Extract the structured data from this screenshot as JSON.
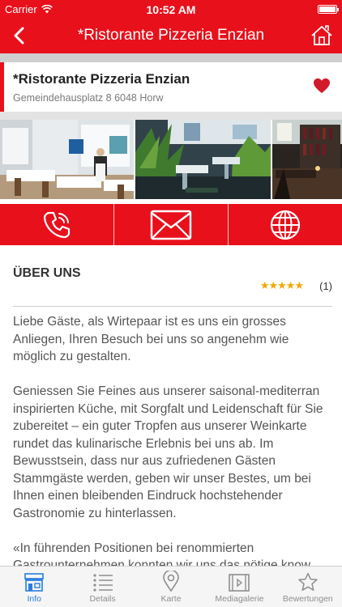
{
  "status_bar": {
    "carrier": "Carrier",
    "time": "10:52 AM"
  },
  "nav": {
    "title": "*Ristorante Pizzeria Enzian",
    "back_icon": "chevron-left-icon",
    "home_icon": "home-icon"
  },
  "restaurant": {
    "name": "*Ristorante Pizzeria Enzian",
    "address": "Gemeindehausplatz 8 6048 Horw",
    "favorite_icon": "heart-icon"
  },
  "actions": [
    {
      "name": "phone",
      "icon": "phone-icon"
    },
    {
      "name": "email",
      "icon": "envelope-icon"
    },
    {
      "name": "website",
      "icon": "globe-icon"
    }
  ],
  "about": {
    "title": "ÜBER UNS",
    "stars": "★★★★★",
    "rating": 5,
    "rating_count": "(1)",
    "paragraphs": [
      "Liebe Gäste, als Wirtepaar ist es uns ein grosses Anliegen, Ihren Besuch bei uns so angenehm wie möglich zu gestalten.",
      "Geniessen Sie Feines aus unserer saisonal-mediterran inspirierten Küche, mit Sorgfalt und Leidenschaft für Sie zubereitet – ein guter Tropfen aus unserer Weinkarte rundet das kulinarische Erlebnis bei uns ab. Im Bewusstsein, dass nur aus zufriedenen Gästen Stammgäste werden, geben wir unser Bestes, um bei Ihnen einen bleibenden Eindruck hochstehender Gastronomie zu hinterlassen.",
      "«In führenden Positionen bei renommierten Gastrounternehmen konnten wir uns das nötige know"
    ]
  },
  "tabs": [
    {
      "label": "Info",
      "icon": "store-icon",
      "active": true
    },
    {
      "label": "Details",
      "icon": "list-icon",
      "active": false
    },
    {
      "label": "Karte",
      "icon": "map-pin-icon",
      "active": false
    },
    {
      "label": "Mediagalerie",
      "icon": "film-icon",
      "active": false
    },
    {
      "label": "Bewertungen",
      "icon": "star-icon",
      "active": false
    }
  ],
  "colors": {
    "brand_red": "#e8101b",
    "star_gold": "#f2a900",
    "tab_active": "#2a7fdc",
    "tab_inactive": "#8e8e8e"
  }
}
